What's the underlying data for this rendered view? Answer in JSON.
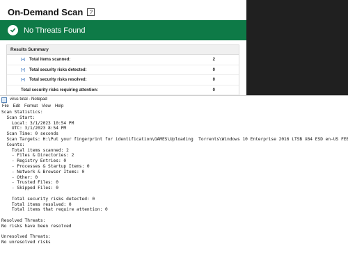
{
  "scan": {
    "title": "On-Demand Scan",
    "status_text": "No Threats Found",
    "results_header": "Results Summary",
    "rows": [
      {
        "expand": "[+]",
        "label": "Total items scanned:",
        "value": "2"
      },
      {
        "expand": "[+]",
        "label": "Total security risks detected:",
        "value": "0"
      },
      {
        "expand": "[+]",
        "label": "Total security risks resolved:",
        "value": "0"
      },
      {
        "expand": "",
        "label": "Total security risks requiring attention:",
        "value": "0"
      }
    ]
  },
  "notepad": {
    "title": "virus total - Notepad",
    "menu": [
      "File",
      "Edit",
      "Format",
      "View",
      "Help"
    ],
    "lines": [
      "Scan Statistics:",
      "  Scan Start:",
      "    Local: 3/1/2023 10:54 PM",
      "    UTC: 3/1/2023 8:54 PM",
      "  Scan Time: 0 seconds",
      "  Scan Targets: H:\\Put your fingerprint for identification\\GAMES\\Uploading  Torrents\\Windows 10 Enterprise 2016 LTSB X64 ESD en-US FEB 2023",
      "  Counts:",
      "    Total items scanned: 2",
      "    - Files & Directories: 2",
      "    - Registry Entries: 0",
      "    - Processes & Startup Items: 0",
      "    - Network & Browser Items: 0",
      "    - Other: 0",
      "    - Trusted Files: 0",
      "    - Skipped Files: 0",
      "",
      "    Total security risks detected: 0",
      "    Total items resolved: 0",
      "    Total items that require attention: 0",
      "",
      "Resolved Threats:",
      "No risks have been resolved",
      "",
      "Unresolved Threats:",
      "No unresolved risks"
    ]
  },
  "colors": {
    "banner_green": "#0e7a47",
    "link_blue": "#1a5fb4",
    "dark_background": "#202020"
  },
  "icons": {
    "help": "help-icon",
    "status": "check-circle-icon",
    "notepad": "notepad-icon"
  }
}
